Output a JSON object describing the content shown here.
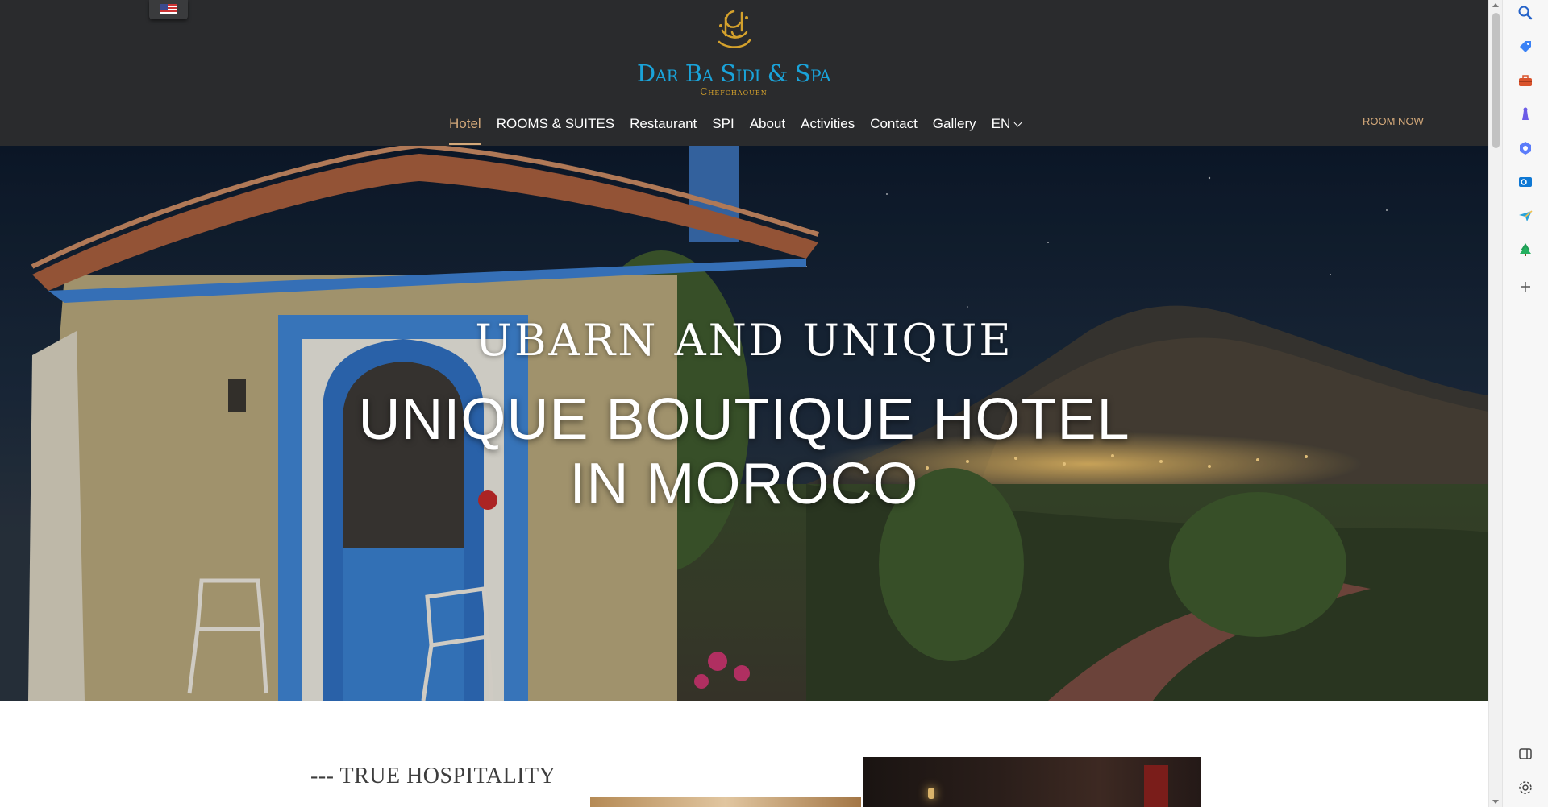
{
  "header": {
    "language_flag": "us-flag-icon",
    "logo": {
      "name": "Dar Ba Sidi & Spa",
      "subtitle": "Chefchaouen"
    },
    "nav": [
      {
        "label": "Hotel",
        "active": true
      },
      {
        "label": "ROOMS & SUITES"
      },
      {
        "label": "Restaurant"
      },
      {
        "label": "SPI"
      },
      {
        "label": "About"
      },
      {
        "label": "Activities"
      },
      {
        "label": "Contact"
      },
      {
        "label": "Gallery"
      },
      {
        "label": "EN"
      }
    ],
    "cta": "ROOM NOW"
  },
  "hero": {
    "kicker": "UBARN AND UNIQUE",
    "title_line1": "UNIQUE BOUTIQUE HOTEL",
    "title_line2": "IN MOROCO"
  },
  "intro": {
    "heading": "--- TRUE HOSPITALITY"
  },
  "edge_sidebar": {
    "items": [
      "search-icon",
      "tag-icon",
      "toolbox-icon",
      "chess-icon",
      "copilot-icon",
      "outlook-icon",
      "paper-plane-icon",
      "tree-icon",
      "add-icon"
    ],
    "bottom": [
      "sidebar-toggle-icon",
      "settings-icon"
    ]
  },
  "colors": {
    "header_bg": "#2a2b2d",
    "accent_gold": "#d4a97a",
    "logo_blue": "#1aa3d9"
  }
}
